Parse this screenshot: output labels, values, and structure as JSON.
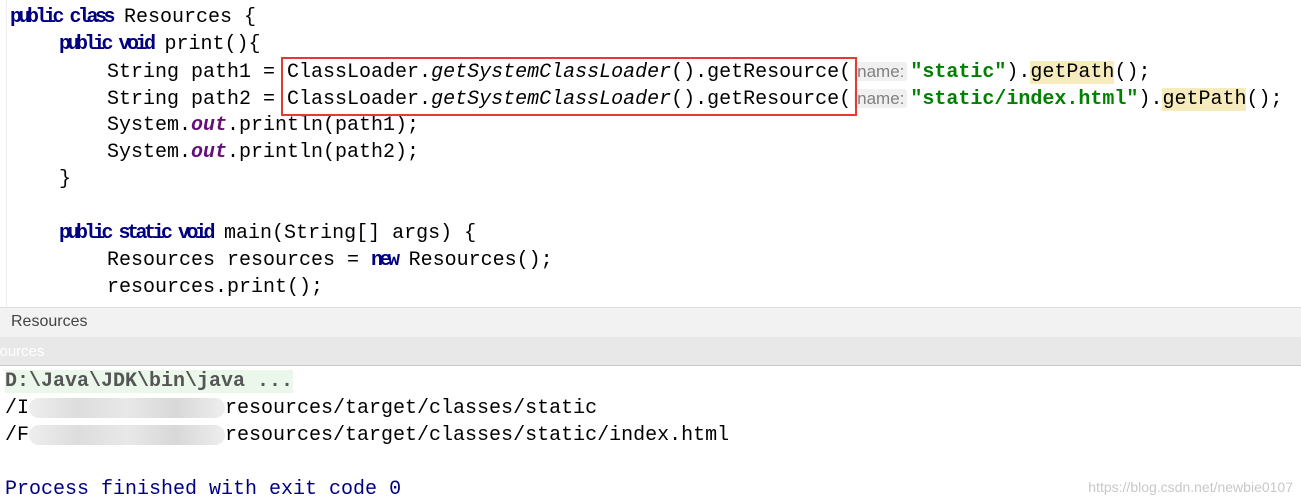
{
  "editor": {
    "line1": {
      "kw": "public class",
      "rest": " Resources {"
    },
    "line2": {
      "kw": "public void",
      "rest": " print(){"
    },
    "line3": {
      "pre": "String path1 = ",
      "cls": "ClassLoader.",
      "method": "getSystemClassLoader",
      "mid": "().getResource(",
      "hint": "name:",
      "arg": "\"static\"",
      "close": ").",
      "getpath": "getPath",
      "end": "();"
    },
    "line4": {
      "pre": "String path2 = ",
      "cls": "ClassLoader.",
      "method": "getSystemClassLoader",
      "mid": "().getResource(",
      "hint": "name:",
      "arg": "\"static/index.html\"",
      "close": ").",
      "getpath": "getPath",
      "end": "();"
    },
    "line5": {
      "pre": "System.",
      "field": "out",
      "rest": ".println(path1);"
    },
    "line6": {
      "pre": "System.",
      "field": "out",
      "rest": ".println(path2);"
    },
    "line7": "}",
    "line8": {
      "kw": "public static void",
      "rest": " main(String[] args) {"
    },
    "line9": {
      "pre": "Resources resources = ",
      "kw": "new",
      "rest": " Resources();"
    },
    "line10": "resources.print();"
  },
  "run_tab": {
    "label": "Resources"
  },
  "run_subbar": {
    "label": "sources"
  },
  "console": {
    "command": "D:\\Java\\JDK\\bin\\java ...",
    "out1_prefix": "/I",
    "out1_suffix": "resources/target/classes/static",
    "out2_prefix": "/F",
    "out2_suffix": "resources/target/classes/static/index.html",
    "exit": "Process finished with exit code 0"
  },
  "watermark": "https://blog.csdn.net/newbie0107",
  "colors": {
    "keyword": "#000080",
    "string": "#008000",
    "highlight_box": "#e53935"
  }
}
